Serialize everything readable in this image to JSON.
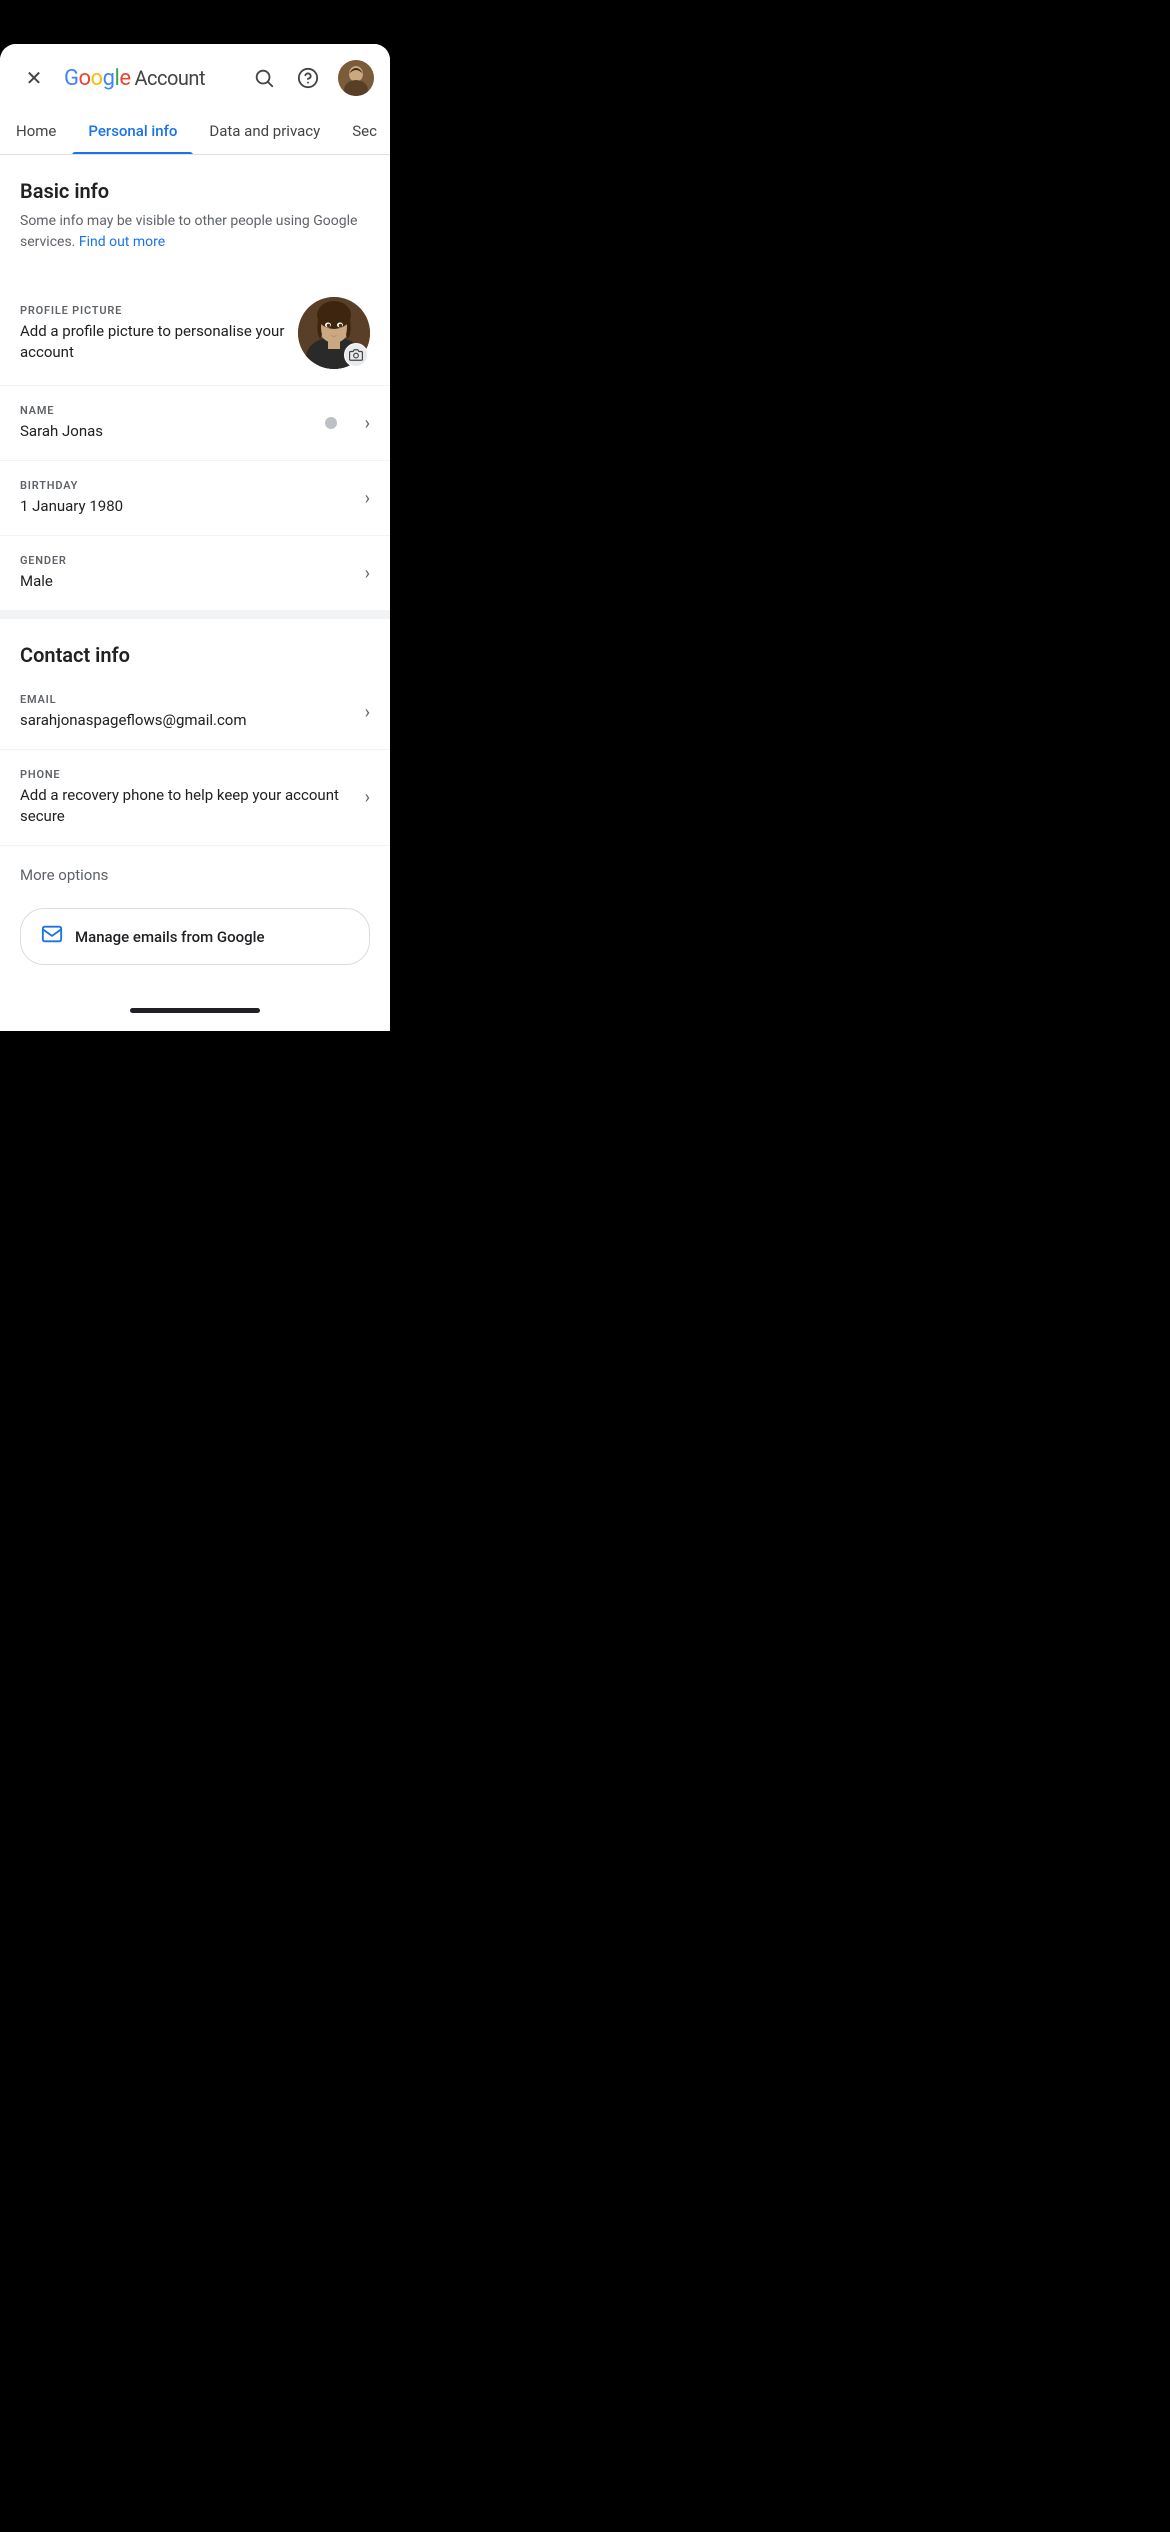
{
  "statusBar": {
    "visible": true
  },
  "header": {
    "closeLabel": "×",
    "logoGoogle": "Google",
    "logoAccount": " Account",
    "searchTitle": "Search",
    "helpTitle": "Help",
    "avatarAlt": "User avatar"
  },
  "nav": {
    "tabs": [
      {
        "id": "home",
        "label": "Home",
        "active": false
      },
      {
        "id": "personal-info",
        "label": "Personal info",
        "active": true
      },
      {
        "id": "data-privacy",
        "label": "Data and privacy",
        "active": false
      },
      {
        "id": "security",
        "label": "Sec...",
        "active": false
      }
    ]
  },
  "basicInfo": {
    "title": "Basic info",
    "description": "Some info may be visible to other people using Google services.",
    "findOutMoreLabel": "Find out more",
    "profilePicture": {
      "label": "PROFILE PICTURE",
      "value": "Add a profile picture to personalise your account"
    },
    "name": {
      "label": "NAME",
      "value": "Sarah Jonas"
    },
    "birthday": {
      "label": "BIRTHDAY",
      "value": "1 January 1980"
    },
    "gender": {
      "label": "GENDER",
      "value": "Male"
    }
  },
  "contactInfo": {
    "title": "Contact info",
    "email": {
      "label": "EMAIL",
      "value": "sarahjonaspageflows@gmail.com"
    },
    "phone": {
      "label": "PHONE",
      "value": "Add a recovery phone to help keep your account secure"
    },
    "moreOptionsLabel": "More options",
    "manageEmailsLabel": "Manage emails from Google"
  }
}
